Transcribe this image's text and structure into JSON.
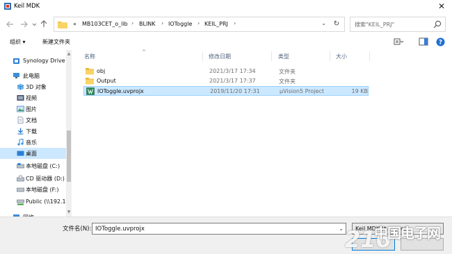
{
  "window": {
    "title": "Keil MDK",
    "close_glyph": "✕"
  },
  "nav": {
    "back_icon": "arrow-left-icon",
    "forward_icon": "arrow-right-icon",
    "dropdown_icon": "chevron-down-icon",
    "up_icon": "arrow-up-icon"
  },
  "address": {
    "overflow": "«",
    "crumbs": [
      "MB103CET_o_lib",
      "BLINK",
      "IOToggle",
      "KEIL_PRJ"
    ],
    "separator": "›",
    "dropdown": "⌄",
    "refresh": "↻"
  },
  "search": {
    "placeholder": "搜索\"KEIL_PRJ\""
  },
  "toolbar": {
    "organize": "组织 ▾",
    "new_folder": "新建文件夹"
  },
  "sidebar": {
    "items": [
      {
        "label": "Synology Drive",
        "icon": "synology-icon",
        "color": "#2a7fd4"
      },
      {
        "label": "此电脑",
        "icon": "computer-icon",
        "color": "#3b8ed8"
      },
      {
        "label": "3D 对象",
        "icon": "cube-icon",
        "color": "#4aa3df"
      },
      {
        "label": "视频",
        "icon": "video-icon",
        "color": "#5a5a8a"
      },
      {
        "label": "图片",
        "icon": "picture-icon",
        "color": "#4a88c8"
      },
      {
        "label": "文档",
        "icon": "document-icon",
        "color": "#7a8aa8"
      },
      {
        "label": "下载",
        "icon": "download-icon",
        "color": "#2a7fd4"
      },
      {
        "label": "音乐",
        "icon": "music-icon",
        "color": "#3b8ed8"
      },
      {
        "label": "桌面",
        "icon": "desktop-icon",
        "color": "#2a7fd4"
      },
      {
        "label": "本地磁盘 (C:)",
        "icon": "drive-icon",
        "color": "#6a7a8a"
      },
      {
        "label": "CD 驱动器 (D:)",
        "icon": "cd-drive-icon",
        "color": "#6a7a8a"
      },
      {
        "label": "本地磁盘 (F:)",
        "icon": "drive-icon",
        "color": "#6a7a8a"
      },
      {
        "label": "Public (\\\\192.16",
        "icon": "network-drive-icon",
        "color": "#3a9a3a"
      },
      {
        "label": "网络",
        "icon": "network-icon",
        "color": "#3b8ed8"
      }
    ]
  },
  "columns": {
    "name": "名称",
    "date": "修改日期",
    "type": "类型",
    "size": "大小"
  },
  "files": [
    {
      "name": "obj",
      "date": "2021/3/17 17:34",
      "type": "文件夹",
      "size": "",
      "icon": "folder-icon"
    },
    {
      "name": "Output",
      "date": "2021/3/17 17:37",
      "type": "文件夹",
      "size": "",
      "icon": "folder-icon"
    },
    {
      "name": "IOToggle.uvprojx",
      "date": "2019/11/20 17:31",
      "type": "µVision5 Project",
      "size": "19 KB",
      "icon": "uvision-project-icon"
    }
  ],
  "bottom": {
    "filename_label": "文件名(N):",
    "filename_value": "IOToggle.uvprojx",
    "filetype_value": "Keil MDK (*.uvproj",
    "dropdown": "⌄"
  },
  "watermark": {
    "number": "216",
    "text": "中国电子网"
  },
  "colors": {
    "selection": "#cce8ff",
    "selection_border": "#99d1ff",
    "folder": "#f4c542",
    "accent": "#0078d7"
  }
}
